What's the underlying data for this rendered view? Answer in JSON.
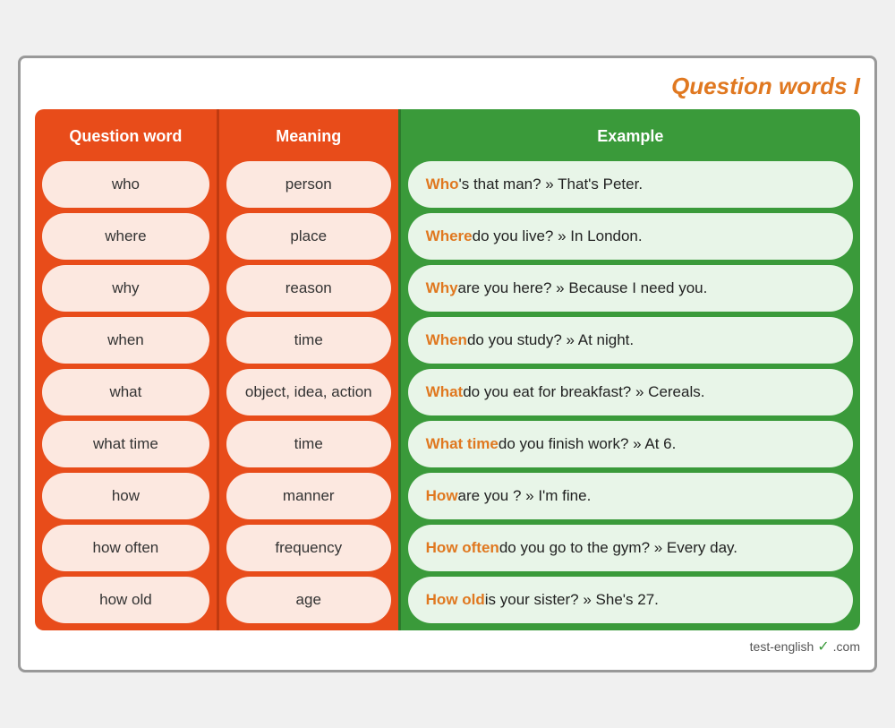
{
  "title": "Question words I",
  "headers": {
    "question_word": "Question word",
    "meaning": "Meaning",
    "example": "Example"
  },
  "rows": [
    {
      "question": "who",
      "meaning": "person",
      "example_word": "Who",
      "example_rest": "'s that man? » That's Peter."
    },
    {
      "question": "where",
      "meaning": "place",
      "example_word": "Where",
      "example_rest": " do you live? » In London."
    },
    {
      "question": "why",
      "meaning": "reason",
      "example_word": "Why",
      "example_rest": " are you here? » Because I need you."
    },
    {
      "question": "when",
      "meaning": "time",
      "example_word": "When",
      "example_rest": " do you study? » At night."
    },
    {
      "question": "what",
      "meaning": "object, idea, action",
      "example_word": "What",
      "example_rest": " do you eat for breakfast? » Cereals."
    },
    {
      "question": "what time",
      "meaning": "time",
      "example_word": "What time",
      "example_rest": " do you finish work? » At 6."
    },
    {
      "question": "how",
      "meaning": "manner",
      "example_word": "How",
      "example_rest": " are you ? » I'm fine."
    },
    {
      "question": "how often",
      "meaning": "frequency",
      "example_word": "How often",
      "example_rest": " do you go to the gym? » Every day."
    },
    {
      "question": "how old",
      "meaning": "age",
      "example_word": "How old",
      "example_rest": " is your sister? » She's 27."
    }
  ],
  "footer": "test-english",
  "footer_domain": ".com"
}
